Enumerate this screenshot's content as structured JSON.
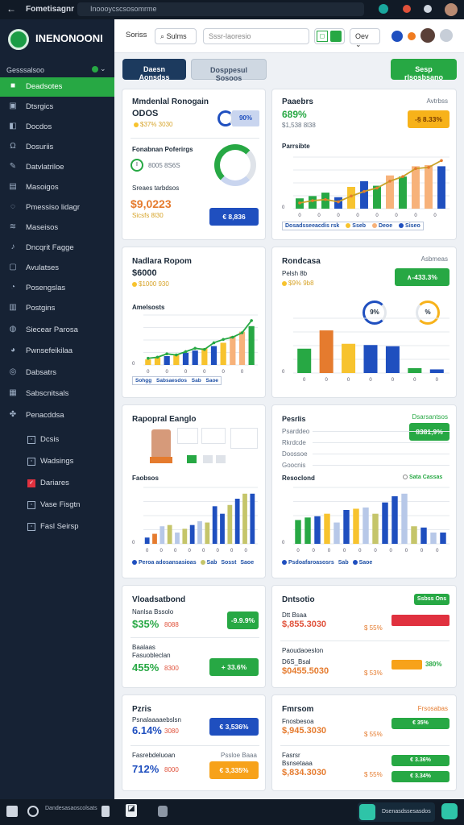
{
  "topbar": {
    "back": "←",
    "title": "Fometisagnr",
    "url": "Inoooycscsosomrme"
  },
  "sidebar": {
    "logo": "INENONOONI",
    "workspace": "Gesssalsoo",
    "items": [
      {
        "label": "Deadsotes",
        "icon": "■",
        "active": true
      },
      {
        "label": "Dtsrgics",
        "icon": "▣"
      },
      {
        "label": "Docdos",
        "icon": "◧"
      },
      {
        "label": "Dosuriis",
        "icon": "Ω"
      },
      {
        "label": "Datvlatriloe",
        "icon": "✎"
      },
      {
        "label": "Masoigos",
        "icon": "▤"
      },
      {
        "label": "Pmessiso lidagr",
        "icon": "◌"
      },
      {
        "label": "Maseisos",
        "icon": "≋"
      },
      {
        "label": "Dncqrit Fagge",
        "icon": "♪"
      },
      {
        "label": "Avulatses",
        "icon": "▢"
      },
      {
        "label": "Posengslas",
        "icon": "◔"
      },
      {
        "label": "Postgins",
        "icon": "▥"
      },
      {
        "label": "Siecear Parosa",
        "icon": "◍"
      },
      {
        "label": "Pwnsefeikilaa",
        "icon": "◕"
      },
      {
        "label": "Dabsatrs",
        "icon": "◎"
      },
      {
        "label": "Sabscnitsals",
        "icon": "▦"
      },
      {
        "label": "Penacddsa",
        "icon": "✤"
      }
    ],
    "subitems": [
      {
        "label": "Dcsis",
        "icon": "▫"
      },
      {
        "label": "Wadsings",
        "icon": "▫"
      },
      {
        "label": "Dariares",
        "icon": "✓"
      },
      {
        "label": "Vase Fisgtn",
        "icon": "▫"
      },
      {
        "label": "Fasl Seirsp",
        "icon": "▫"
      }
    ]
  },
  "header": {
    "tab": "Soriss",
    "search_btn": "Sulms",
    "search_placeholder": "Sssr-laoresio",
    "toggle": "◻",
    "user_btn": "Oev",
    "colors": {
      "blue": "#1f4fbf",
      "orange": "#f07b1f"
    }
  },
  "actions": {
    "primary": "Daesn Aonsdss",
    "secondary": "Dosppesul Sosoos",
    "cta": "Sesp rlsosbsano"
  },
  "cards": {
    "c1": {
      "title": "Mmdenlal Ronogain",
      "v1": "ODOS",
      "s1": "$37% 3030",
      "b1": "90%",
      "sub2": "Fonabnan Poferirgs",
      "s2": "8005 8S6S",
      "v3": "$9,0223",
      "s3": "Sicsfs 8l30",
      "s4": "Sreaes tarbdsos",
      "pill": "€ 8,836"
    },
    "c2": {
      "title": "Paaebrs",
      "right": "Avtrbss",
      "v1": "689%",
      "s1": "$1,538 8l38",
      "pill": "-§ 8.33%",
      "chart": "Parrsibte",
      "legend": [
        "Dosadsseeacdis rsk",
        "Sseb",
        "Deoe",
        "Siseo"
      ]
    },
    "c3": {
      "title": "Nadlara Ropom",
      "v1": "$6000",
      "s1": "$1000 930",
      "chart": "Amelsosts",
      "legend": [
        "Sohgg",
        "Sabsaesdos",
        "Sab",
        "Saoe"
      ]
    },
    "c4": {
      "title": "Rondcasa",
      "right": "Asbmeas",
      "s1": "Pelsh 8b",
      "s2": "$9% 9b8",
      "pill": "∧-433.3%",
      "g1": "9%",
      "g2": "%"
    },
    "c5": {
      "title": "Rapopral Eanglo",
      "chart": "Faobsos",
      "legend": [
        "Peroa adosansasioas",
        "Sab",
        "Sosst",
        "Saoe"
      ]
    },
    "c6": {
      "title": "Pesrlis",
      "right": "Dsarsantsos",
      "pill": "8381,9%",
      "rows": [
        "Psarddeo",
        "Rkrdcde",
        "Doossoe",
        "Goocnis"
      ],
      "chart": "Resoclond",
      "legend_top": "Sata Cassas",
      "legend": [
        "Psdoafaroasosrs",
        "Sab",
        "Saoe"
      ]
    },
    "c7": {
      "title": "Vloadsatbond",
      "top": "Nanlsa Bssolo",
      "v1": "$35%",
      "s1": "8088",
      "pill1": "-9.9.9%",
      "sub2": "Baalaas",
      "sub2b": "Fasuobleclan",
      "v2": "455%",
      "s2": "8300",
      "pill2": "+ 33.6%"
    },
    "c8": {
      "title": "Dntsotio",
      "right": "Ssbss Ons",
      "s1": "Dtt Bsaa",
      "v1": "$,855.3030",
      "s2": "$ 55%",
      "sub2": "Paoudaoeslon",
      "s3": "D6S_Bsal",
      "v2": "$0455.5030",
      "s4": "$ 53%",
      "pct": "380%"
    },
    "c9": {
      "title": "Pzris",
      "right": "Psnalaaaaebslsn",
      "v1": "6.14%",
      "s1": "3080",
      "pill1": "€ 3,536%",
      "sub2": "Fasrebdeluoan",
      "right2": "Pssloe Baaa",
      "v2": "712%",
      "s2": "8000",
      "pill2": "€ 3,335%"
    },
    "c10": {
      "title": "Fmrsom",
      "right": "Frsosabas",
      "s1": "Fnosbesoa",
      "v1": "$,945.3030",
      "s2": "$ 55%",
      "pill1": "€ 35%",
      "sub2": "Fasrsr",
      "s3": "Bsnsetaaa",
      "v2": "$,834.3030",
      "s4": "$ 55%",
      "pill2": "€ 3.36%",
      "pill3": "€ 3.34%"
    }
  },
  "bottombar": {
    "text1": "Dandesasaoscolsats",
    "text2": "Dsenasdssesasdos",
    "icon": "◪"
  },
  "chart_data": [
    {
      "type": "bar",
      "name": "c2",
      "categories": [
        "0",
        "0",
        "0",
        "0",
        "0",
        "0",
        "0",
        "0",
        "0",
        "0",
        "0",
        "0"
      ],
      "values": [
        18,
        22,
        28,
        20,
        38,
        48,
        40,
        58,
        56,
        74,
        76,
        74
      ],
      "series_colors": [
        "#27a844",
        "#27a844",
        "#27a844",
        "#1f4fbf",
        "#f7c32e",
        "#1f4fbf",
        "#27a844",
        "#f7b27a",
        "#27a844",
        "#f7b27a",
        "#f7b27a",
        "#1f4fbf"
      ],
      "line": [
        10,
        14,
        16,
        12,
        22,
        30,
        36,
        48,
        56,
        70,
        72,
        84
      ],
      "ylim": [
        0,
        90
      ]
    },
    {
      "type": "bar",
      "name": "c3",
      "values": [
        10,
        14,
        16,
        18,
        22,
        26,
        30,
        34,
        40,
        52,
        60,
        70
      ],
      "line": [
        12,
        14,
        20,
        18,
        24,
        30,
        28,
        40,
        46,
        50,
        58,
        80
      ],
      "ylim": [
        0,
        90
      ]
    },
    {
      "type": "bar",
      "name": "c4",
      "values": [
        40,
        70,
        48,
        46,
        44,
        8,
        6
      ],
      "colors": [
        "#27a844",
        "#e57b2e",
        "#f7c32e",
        "#1f4fbf",
        "#1f4fbf",
        "#27a844",
        "#1f4fbf"
      ],
      "ylim": [
        0,
        90
      ]
    },
    {
      "type": "bar",
      "name": "c5",
      "values": [
        10,
        16,
        28,
        30,
        18,
        24,
        30,
        36,
        34,
        60,
        48,
        62,
        72,
        80,
        80
      ],
      "ylim": [
        0,
        90
      ]
    },
    {
      "type": "bar",
      "name": "c6",
      "values": [
        38,
        42,
        44,
        48,
        34,
        54,
        56,
        58,
        48,
        66,
        76,
        80,
        28,
        26,
        18,
        18
      ],
      "ylim": [
        0,
        90
      ]
    }
  ]
}
